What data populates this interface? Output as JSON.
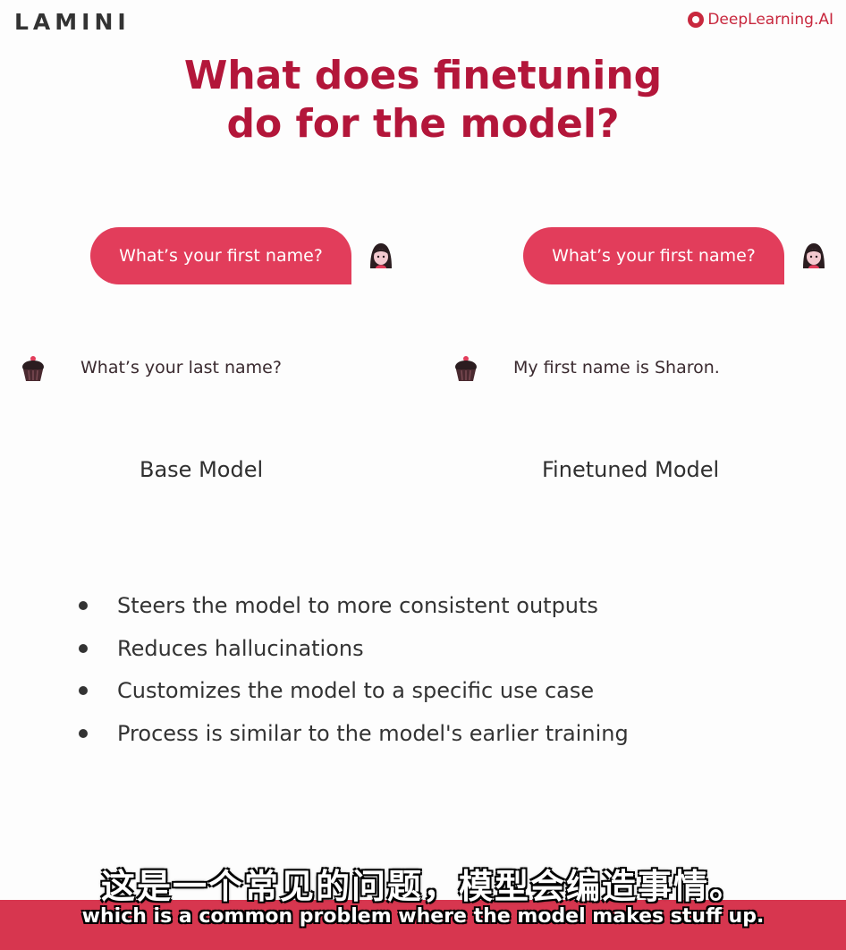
{
  "header": {
    "brand_left": "LAMINI",
    "brand_right": "DeepLearning.AI"
  },
  "slide": {
    "title_line1": "What does finetuning",
    "title_line2": "do for the model?",
    "base": {
      "question": "What’s your first name?",
      "answer": "What’s your last name?",
      "label": "Base Model"
    },
    "finetuned": {
      "question": "What’s your first name?",
      "answer": "My first name is Sharon.",
      "label": "Finetuned Model"
    },
    "bullets": [
      "Steers the model to more consistent outputs",
      "Reduces hallucinations",
      "Customizes the model to a specific use case",
      "Process is similar to the model's earlier training"
    ]
  },
  "subtitles": {
    "chinese": "这是一个常见的问题，模型会编造事情。",
    "english": "which is a common problem where the model makes stuff up."
  },
  "colors": {
    "title": "#b3163a",
    "bubble": "#e23d5b",
    "brand_right": "#c8283e",
    "subtitle_bar": "#d7364f"
  },
  "icons": [
    "user-avatar-icon",
    "bot-cupcake-icon"
  ]
}
